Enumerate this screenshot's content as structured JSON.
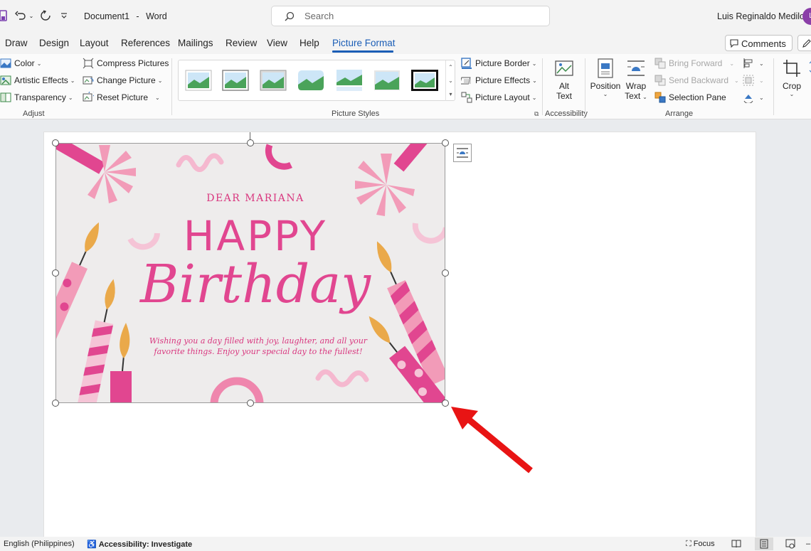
{
  "titlebar": {
    "document_name": "Document1",
    "separator": "-",
    "app_name": "Word",
    "search_placeholder": "Search",
    "user_name": "Luis Reginaldo Medilo",
    "user_initial": "L"
  },
  "tabs": [
    "Draw",
    "Design",
    "Layout",
    "References",
    "Mailings",
    "Review",
    "View",
    "Help",
    "Picture Format"
  ],
  "active_tab": "Picture Format",
  "comments_label": "Comments",
  "ribbon": {
    "adjust": {
      "color": "Color",
      "artistic_effects": "Artistic Effects",
      "transparency": "Transparency",
      "compress_pictures": "Compress Pictures",
      "change_picture": "Change Picture",
      "reset_picture": "Reset Picture",
      "label": "Adjust"
    },
    "picture_styles": {
      "label": "Picture Styles",
      "picture_border": "Picture Border",
      "picture_effects": "Picture Effects",
      "picture_layout": "Picture Layout"
    },
    "accessibility": {
      "alt_text_line1": "Alt",
      "alt_text_line2": "Text",
      "label": "Accessibility"
    },
    "arrange": {
      "position": "Position",
      "wrap_line1": "Wrap",
      "wrap_line2": "Text",
      "bring_forward": "Bring Forward",
      "send_backward": "Send Backward",
      "selection_pane": "Selection Pane",
      "label": "Arrange"
    },
    "size": {
      "crop": "Crop"
    }
  },
  "picture": {
    "dear": "DEAR MARIANA",
    "happy": "HAPPY",
    "birthday": "Birthday",
    "wish_line1": "Wishing you a day filled with joy, laughter, and all your",
    "wish_line2": "favorite things. Enjoy your special day to the fullest!"
  },
  "statusbar": {
    "language": "English (Philippines)",
    "accessibility": "Accessibility: Investigate",
    "focus": "Focus"
  },
  "colors": {
    "accent_blue": "#1b5eb6",
    "card_pink": "#e14690",
    "card_background": "#eeecec",
    "arrow_red": "#e81414"
  }
}
